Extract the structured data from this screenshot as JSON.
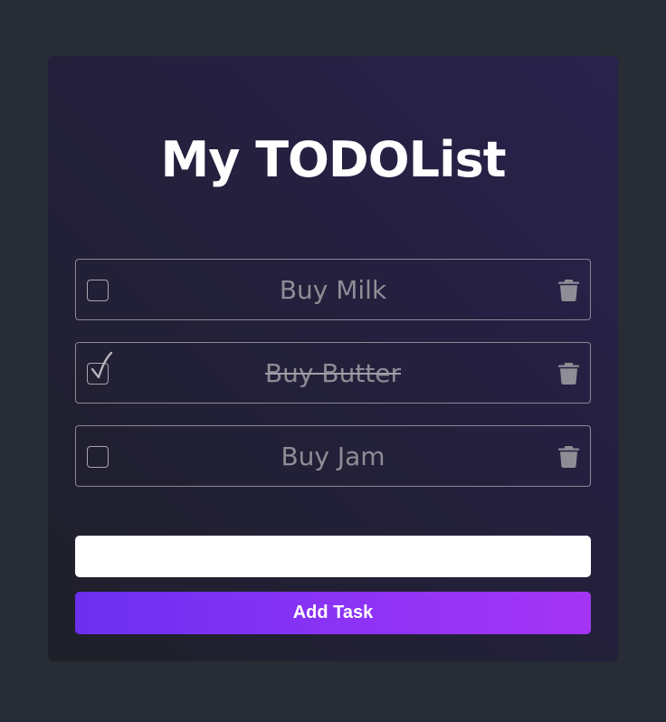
{
  "app": {
    "title": "My TODOList"
  },
  "tasks": [
    {
      "text": "Buy Milk",
      "completed": false
    },
    {
      "text": "Buy Butter",
      "completed": true
    },
    {
      "text": "Buy Jam",
      "completed": false
    }
  ],
  "new_task_input": {
    "value": "",
    "placeholder": ""
  },
  "add_button": {
    "label": "Add Task"
  },
  "icons": {
    "checkbox_checked": "check-icon",
    "delete": "trash-icon"
  },
  "colors": {
    "page_background": "#282c34",
    "card_background": "#24203d",
    "text_muted": "#8e8d96",
    "button_gradient_start": "#6b2ff0",
    "button_gradient_end": "#a534f5"
  }
}
